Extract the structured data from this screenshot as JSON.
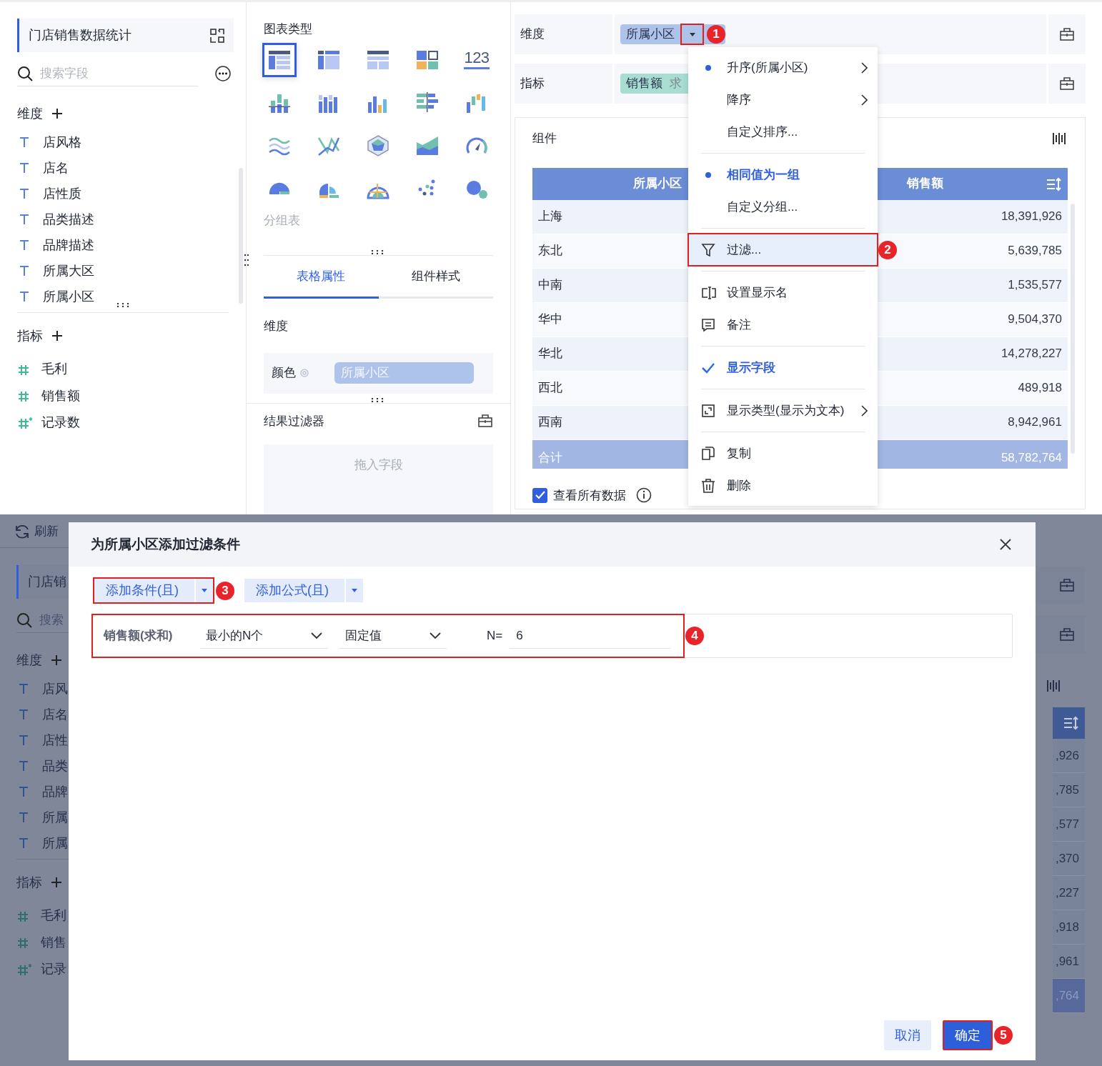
{
  "top": {
    "sidebar": {
      "title": "门店销售数据统计",
      "search_placeholder": "搜索字段",
      "dimensions_label": "维度",
      "dimension_fields": [
        "店风格",
        "店名",
        "店性质",
        "品类描述",
        "品牌描述",
        "所属大区",
        "所属小区"
      ],
      "measures_label": "指标",
      "measure_fields": [
        {
          "name": "毛利",
          "kind": "number"
        },
        {
          "name": "销售额",
          "kind": "number"
        },
        {
          "name": "记录数",
          "kind": "count"
        }
      ]
    },
    "chart_panel": {
      "title": "图表类型",
      "chart_types": [
        {
          "kind": "group-table",
          "selected": true
        },
        {
          "kind": "cross-table",
          "selected": false
        },
        {
          "kind": "detail-table",
          "selected": false
        },
        {
          "kind": "treemap",
          "selected": false
        },
        {
          "kind": "kpi",
          "label": "123",
          "selected": false
        },
        {
          "kind": "stacked-bar",
          "selected": false
        },
        {
          "kind": "multi-bar",
          "selected": false
        },
        {
          "kind": "bar",
          "selected": false
        },
        {
          "kind": "horizontal-bar",
          "selected": false
        },
        {
          "kind": "waterfall",
          "selected": false
        },
        {
          "kind": "wave",
          "selected": false
        },
        {
          "kind": "line",
          "selected": false
        },
        {
          "kind": "radar",
          "selected": false
        },
        {
          "kind": "area",
          "selected": false
        },
        {
          "kind": "gauge",
          "selected": false
        },
        {
          "kind": "pie",
          "selected": false
        },
        {
          "kind": "rose",
          "selected": false
        },
        {
          "kind": "sunburst",
          "selected": false
        },
        {
          "kind": "scatter",
          "selected": false
        },
        {
          "kind": "bubble",
          "selected": false
        }
      ],
      "selected_type_name": "分组表",
      "tabs": [
        {
          "label": "表格属性",
          "selected": true
        },
        {
          "label": "组件样式",
          "selected": false
        }
      ],
      "section_label": "维度",
      "color_label": "颜色",
      "color_field": "所属小区",
      "result_filter_title": "结果过滤器",
      "drop_placeholder": "拖入字段"
    },
    "shelf": {
      "dimension_label": "维度",
      "dimension_chip": "所属小区",
      "dimension_callout": "1",
      "measure_label": "指标",
      "measure_chip": "销售额",
      "measure_chip_suffix": "求"
    },
    "component": {
      "title": "组件",
      "columns": [
        "所属小区",
        "销售额"
      ],
      "rows": [
        {
          "region": "上海",
          "value": "18,391,926"
        },
        {
          "region": "东北",
          "value": "5,639,785"
        },
        {
          "region": "中南",
          "value": "1,535,577"
        },
        {
          "region": "华中",
          "value": "9,504,370"
        },
        {
          "region": "华北",
          "value": "14,278,227"
        },
        {
          "region": "西北",
          "value": "489,918"
        },
        {
          "region": "西南",
          "value": "8,942,961"
        }
      ],
      "total": {
        "label": "合计",
        "value": "58,782,764"
      },
      "view_all": {
        "label": "查看所有数据",
        "checked": true
      }
    },
    "context_menu": [
      {
        "kind": "radio",
        "label": "升序(所属小区)",
        "selected": true,
        "emphasis": false,
        "submenu": true
      },
      {
        "kind": "radio",
        "label": "降序",
        "selected": false,
        "emphasis": false,
        "submenu": true
      },
      {
        "kind": "radio",
        "label": "自定义排序...",
        "selected": false,
        "emphasis": false,
        "submenu": false
      },
      {
        "kind": "divider"
      },
      {
        "kind": "radio",
        "label": "相同值为一组",
        "selected": true,
        "emphasis": true,
        "submenu": false
      },
      {
        "kind": "radio",
        "label": "自定义分组...",
        "selected": false,
        "emphasis": false,
        "submenu": false
      },
      {
        "kind": "divider"
      },
      {
        "kind": "filter",
        "label": "过滤...",
        "highlighted": true,
        "callout": "2"
      },
      {
        "kind": "divider"
      },
      {
        "kind": "rename",
        "label": "设置显示名"
      },
      {
        "kind": "note",
        "label": "备注"
      },
      {
        "kind": "divider"
      },
      {
        "kind": "toggle",
        "label": "显示字段",
        "checked": true
      },
      {
        "kind": "divider"
      },
      {
        "kind": "display-type",
        "label": "显示类型(显示为文本)",
        "submenu": true
      },
      {
        "kind": "divider"
      },
      {
        "kind": "copy",
        "label": "复制"
      },
      {
        "kind": "delete",
        "label": "删除"
      }
    ]
  },
  "bottom": {
    "background": {
      "refresh_label": "刷新",
      "sidebar_title": "门店销",
      "search_placeholder": "搜索",
      "dimensions_label": "维度",
      "dimension_fields": [
        "店风",
        "店名",
        "店性",
        "品类",
        "品牌",
        "所属",
        "所属"
      ],
      "measures_label": "指标",
      "measure_fields": [
        {
          "name": "毛利",
          "kind": "number"
        },
        {
          "name": "销售",
          "kind": "number"
        },
        {
          "name": "记录",
          "kind": "count"
        }
      ],
      "values": [
        ",926",
        ",785",
        ",577",
        ",370",
        ",227",
        ",918",
        ",961",
        ",764"
      ]
    },
    "dialog": {
      "title": "为所属小区添加过滤条件",
      "add_buttons": [
        {
          "label": "添加条件(且)",
          "callout": "3"
        },
        {
          "label": "添加公式(且)"
        }
      ],
      "condition": {
        "field": "销售额(求和)",
        "operator": "最小的N个",
        "mode": "固定值",
        "n_label": "N=",
        "n_value": "6",
        "callout": "4"
      },
      "buttons": [
        {
          "label": "取消",
          "kind": "secondary"
        },
        {
          "label": "确定",
          "kind": "primary",
          "callout": "5"
        }
      ]
    }
  }
}
